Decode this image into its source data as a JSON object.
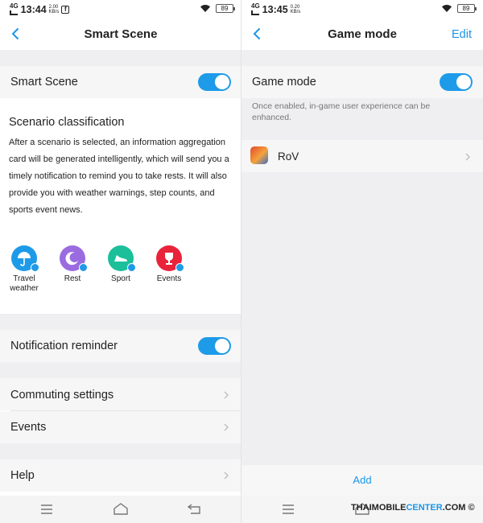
{
  "status_left": {
    "time": "13:44",
    "net": "4G",
    "speed_top": "2.00",
    "speed_bottom": "KB/s",
    "battery": "89"
  },
  "status_right": {
    "time": "13:45",
    "net": "4G",
    "speed_top": "0.20",
    "speed_bottom": "KB/s",
    "battery": "89"
  },
  "smart_scene": {
    "header_title": "Smart Scene",
    "toggle_label": "Smart Scene",
    "toggle_on": true,
    "section_title": "Scenario classification",
    "description": "After a scenario is selected, an information aggregation card will be generated intelligently, which will send you a timely notification to remind you to take rests. It will also provide you with weather warnings, step counts, and sports event news.",
    "scenarios": [
      {
        "label": "Travel weather",
        "icon": "umbrella-icon",
        "color": "#1e9be8",
        "checked": true
      },
      {
        "label": "Rest",
        "icon": "moon-icon",
        "color": "#9b6be0",
        "checked": true
      },
      {
        "label": "Sport",
        "icon": "shoe-icon",
        "color": "#1bbf9a",
        "checked": true
      },
      {
        "label": "Events",
        "icon": "trophy-icon",
        "color": "#e8233a",
        "checked": true
      }
    ],
    "notification_label": "Notification reminder",
    "notification_on": true,
    "commuting_label": "Commuting settings",
    "events_label": "Events",
    "help_label": "Help"
  },
  "game_mode": {
    "header_title": "Game mode",
    "edit_label": "Edit",
    "toggle_label": "Game mode",
    "toggle_on": true,
    "hint": "Once enabled, in-game user experience can be enhanced.",
    "apps": [
      {
        "name": "RoV"
      }
    ],
    "add_label": "Add"
  },
  "watermark": {
    "left": "THAIMOBILE",
    "right": "CENTER",
    "suffix": ".COM"
  },
  "colors": {
    "accent": "#1e9be8",
    "background_gray": "#efeff1"
  }
}
